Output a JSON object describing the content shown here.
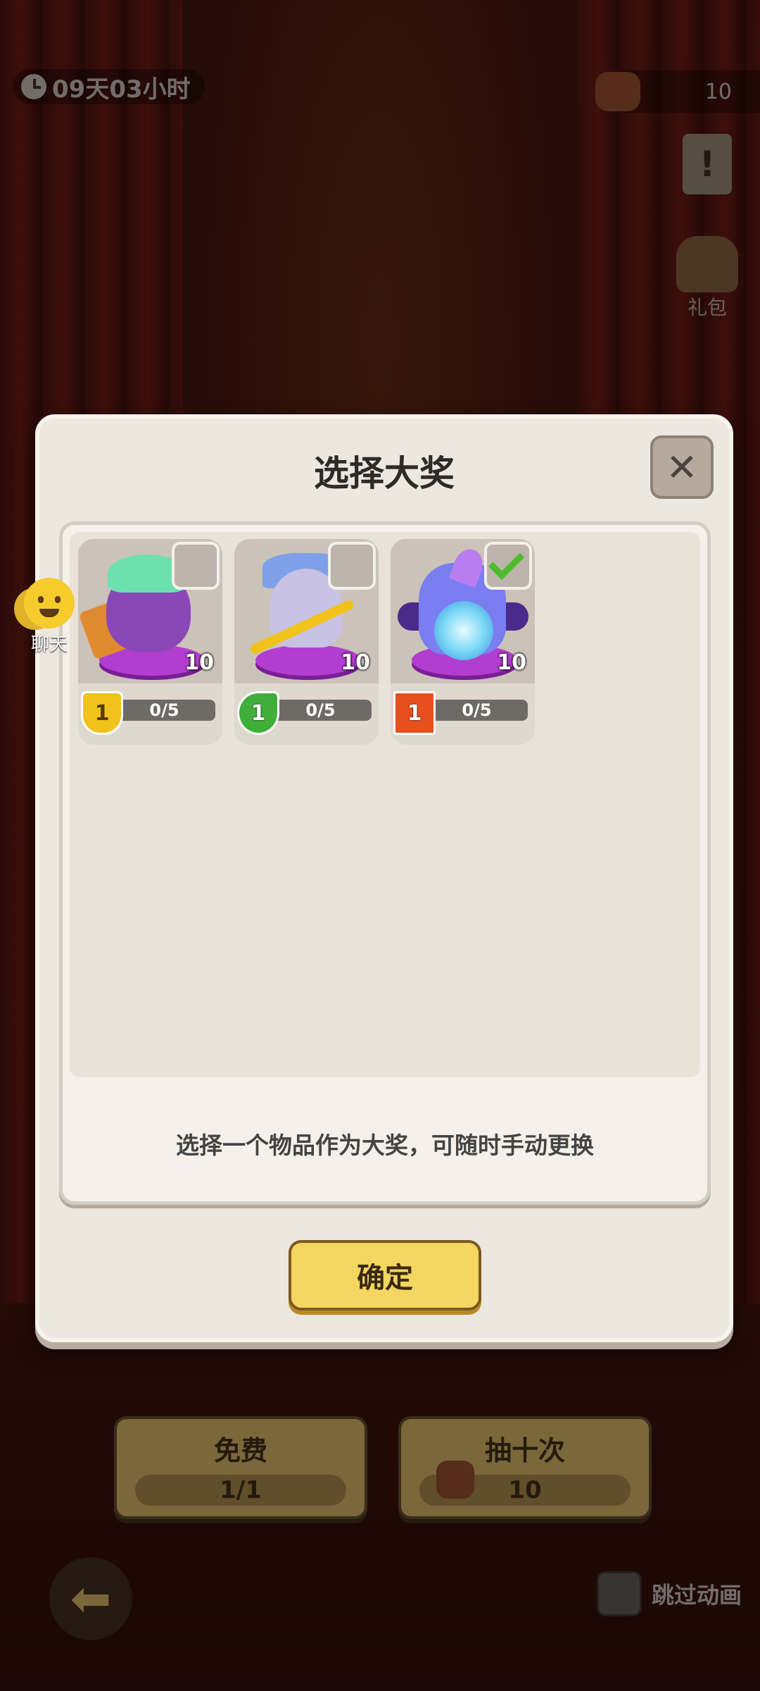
{
  "topbar": {
    "timer": "09天03小时",
    "currency_value": "10"
  },
  "side": {
    "gift_label": "礼包",
    "chat_label": "聊天"
  },
  "dialog": {
    "title": "选择大奖",
    "hint": "选择一个物品作为大奖，可随时手动更换",
    "confirm_label": "确定",
    "items": [
      {
        "count": "10",
        "badge": "1",
        "badge_type": "shield",
        "progress": "0/5",
        "selected": false,
        "icon": "purple-warrior-hero"
      },
      {
        "count": "10",
        "badge": "1",
        "badge_type": "leaf",
        "progress": "0/5",
        "selected": false,
        "icon": "blade-mage-hero"
      },
      {
        "count": "10",
        "badge": "1",
        "badge_type": "flag",
        "progress": "0/5",
        "selected": true,
        "icon": "ice-orb-hero"
      }
    ]
  },
  "bottom": {
    "free_label": "免费",
    "free_value": "1/1",
    "ten_label": "抽十次",
    "ten_value": "10",
    "skip_label": "跳过动画"
  },
  "colors": {
    "accent_yellow": "#f4d660",
    "check_green": "#4dbb2a",
    "dialog_bg": "#ece7df"
  }
}
